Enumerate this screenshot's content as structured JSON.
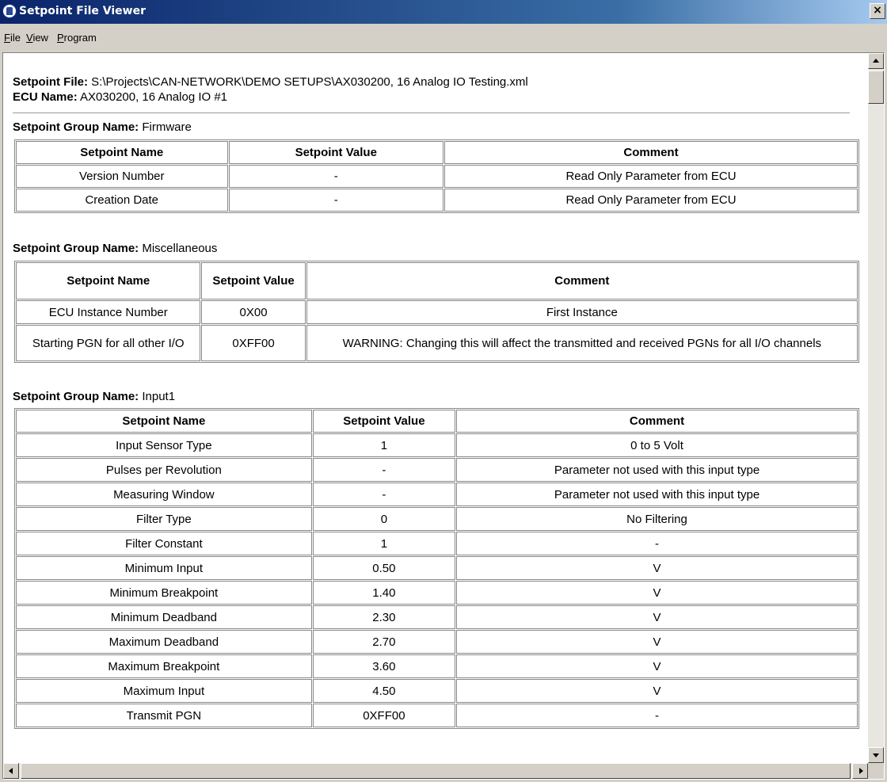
{
  "window": {
    "title": "Setpoint File Viewer",
    "close": "×"
  },
  "menu": [
    {
      "mnemonic": "F",
      "rest": "ile"
    },
    {
      "mnemonic": "V",
      "rest": "iew"
    },
    {
      "mnemonic": "P",
      "rest": "rogram"
    }
  ],
  "file_info": {
    "file_label": "Setpoint File:",
    "file_value": " S:\\Projects\\CAN-NETWORK\\DEMO SETUPS\\AX030200, 16 Analog IO Testing.xml",
    "ecu_label": "ECU Name:",
    "ecu_value": " AX030200, 16 Analog IO #1"
  },
  "group_label": "Setpoint Group Name:",
  "headers": {
    "name": "Setpoint Name",
    "value": "Setpoint Value",
    "comment": "Comment"
  },
  "groups": [
    {
      "name": " Firmware",
      "rows": [
        {
          "name": "Version Number",
          "value": "-",
          "comment": "Read Only Parameter from ECU"
        },
        {
          "name": "Creation Date",
          "value": "-",
          "comment": "Read Only Parameter from ECU"
        }
      ]
    },
    {
      "name": " Miscellaneous",
      "rows": [
        {
          "name": "ECU Instance Number",
          "value": "0X00",
          "comment": "First Instance"
        },
        {
          "name": "Starting PGN for all other I/O",
          "value": "0XFF00",
          "comment": "WARNING: Changing this will affect the transmitted and received PGNs for all I/O channels"
        }
      ]
    },
    {
      "name": " Input1",
      "rows": [
        {
          "name": "Input Sensor Type",
          "value": "1",
          "comment": "0 to 5 Volt"
        },
        {
          "name": "Pulses per Revolution",
          "value": "-",
          "comment": "Parameter not used with this input type"
        },
        {
          "name": "Measuring Window",
          "value": "-",
          "comment": "Parameter not used with this input type"
        },
        {
          "name": "Filter Type",
          "value": "0",
          "comment": "No Filtering"
        },
        {
          "name": "Filter Constant",
          "value": "1",
          "comment": "-"
        },
        {
          "name": "Minimum Input",
          "value": "0.50",
          "comment": "V"
        },
        {
          "name": "Minimum Breakpoint",
          "value": "1.40",
          "comment": "V"
        },
        {
          "name": "Minimum Deadband",
          "value": "2.30",
          "comment": "V"
        },
        {
          "name": "Maximum Deadband",
          "value": "2.70",
          "comment": "V"
        },
        {
          "name": "Maximum Breakpoint",
          "value": "3.60",
          "comment": "V"
        },
        {
          "name": "Maximum Input",
          "value": "4.50",
          "comment": "V"
        },
        {
          "name": "Transmit PGN",
          "value": "0XFF00",
          "comment": "-"
        }
      ]
    }
  ]
}
